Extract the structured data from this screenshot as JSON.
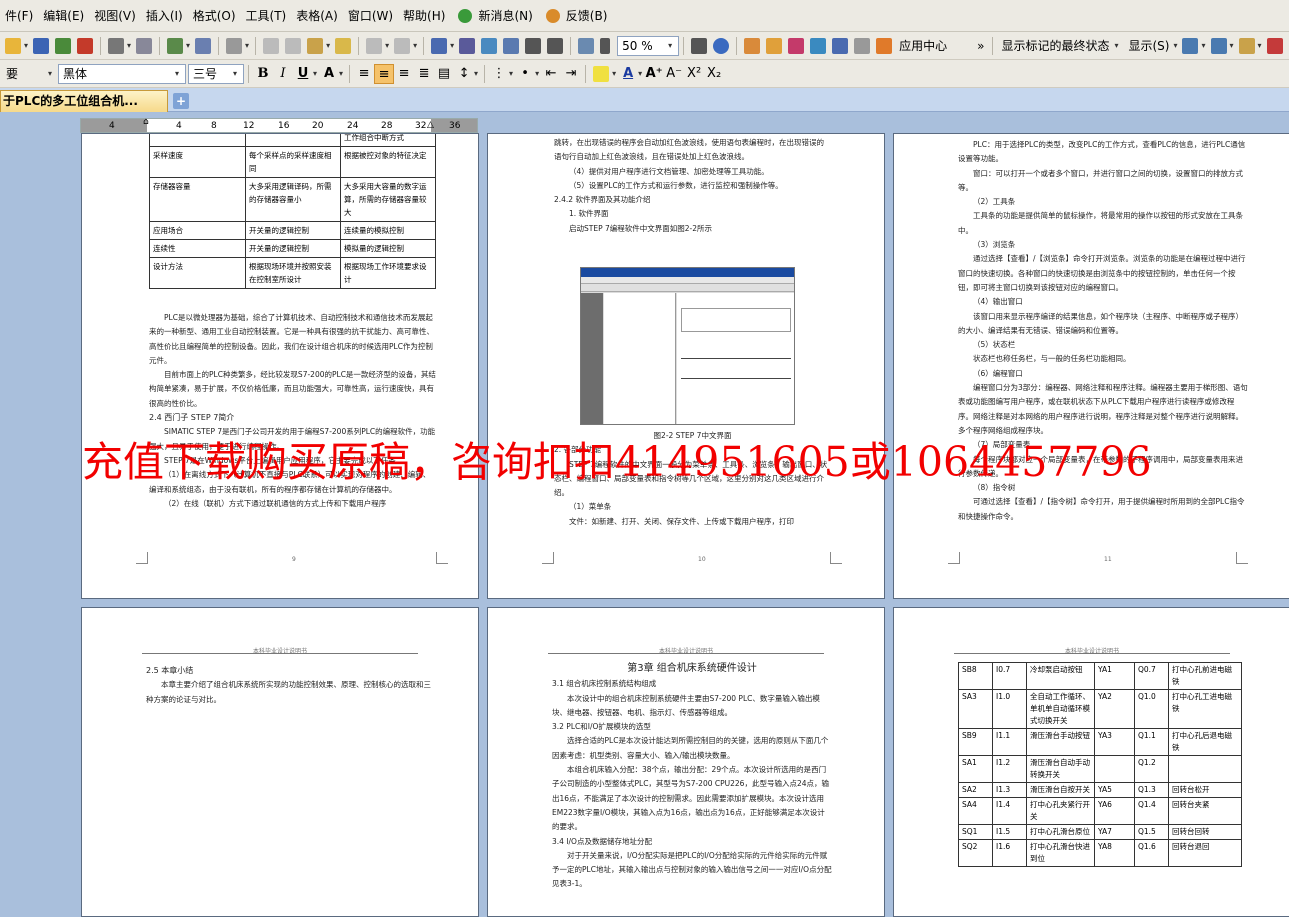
{
  "menu": [
    "件(F)",
    "编辑(E)",
    "视图(V)",
    "插入(I)",
    "格式(O)",
    "工具(T)",
    "表格(A)",
    "窗口(W)",
    "帮助(H)",
    "新消息(N)",
    "反馈(B)"
  ],
  "toolbar": {
    "zoom": "50 %",
    "app_center": "应用中心",
    "markup": "显示标记的最终状态",
    "show": "显示(S)",
    "style": "要",
    "font": "黑体",
    "size": "三号",
    "bold": "B",
    "italic": "I",
    "underline": "U",
    "text_font": "A",
    "superscript": "X²",
    "subscript": "X₂"
  },
  "tab": {
    "title": "于PLC的多工位组合机...",
    "add": "+"
  },
  "ruler": [
    "4",
    "4",
    "8",
    "12",
    "16",
    "20",
    "24",
    "28",
    "32",
    "36"
  ],
  "watermark": "充值下载购买原稿，咨询扣扣414951605或1064457796",
  "page1": {
    "rows": [
      [
        "",
        "",
        "工作组合中断方式"
      ],
      [
        "采样速度",
        "每个采样点的采样速度相同",
        "根据被控对象的特征决定"
      ],
      [
        "存储器容量",
        "大多采用逻辑译码，所需的存储器容量小",
        "大多采用大容量的数字运算，所需的存储器容量较大"
      ],
      [
        "应用场合",
        "开关量的逻辑控制",
        "连续量的模拟控制"
      ],
      [
        "连续性",
        "开关量的逻辑控制",
        "模拟量的逻辑控制"
      ],
      [
        "设计方法",
        "根据现场环境并按照安装在控制室所设计",
        "根据现场工作环境要求设计"
      ]
    ],
    "para1": "PLC是以微处理器为基础，综合了计算机技术、自动控制技术和通信技术而发展起来的一种新型、通用工业自动控制装置。它是一种具有很强的抗干扰能力、高可靠性、高性价比且编程简单的控制设备。因此，我们在设计组合机床的时候选用PLC作为控制元件。",
    "para2": "目前市面上的PLC种类繁多，经比较发现S7-200的PLC是一款经济型的设备，其结构简单紧凑，易于扩展，不仅价格低廉，而且功能强大，可靠性高，运行速度快，具有很高的性价比。",
    "heading": "2.4 西门子 STEP 7简介",
    "para3": "SIMATIC STEP 7是西门子公司开发的用于编程S7-200系列PLC的编程软件，功能强大，且易于使用，便于进行编程操作。",
    "para4": "STEP 7是在Windows平台上编辑用户应用程序，它主要完成以下任务。",
    "para5": "（1）在离线方式下（计算机不直接与PLC联系）可以实现对程序的创建、编辑、编译和系统组态，由于没有联机，所有的程序都存储在计算机的存储器中。",
    "para6": "（2）在线（联机）方式下通过联机通信的方式上传和下载用户程序",
    "pnum": "9"
  },
  "page2": {
    "p1": "跳转，在出现错误的程序会自动加红色波浪线，使用语句表编程时，在出现错误的语句行自动加上红色波浪线，且在错误处加上红色波浪线。",
    "p2": "（4）提供对用户程序进行文档管理、加密处理等工具功能。",
    "p3": "（5）设置PLC的工作方式和运行参数，进行监控和强制操作等。",
    "h1": "2.4.2 软件界面及其功能介绍",
    "h2": "1. 软件界面",
    "p4": "启动STEP 7编程软件中文界面如图2-2所示",
    "caption": "图2-2 STEP 7中文界面",
    "h3": "2. 各部分功能",
    "p5": "STEP 7编程软件的中文界面一般分为菜单条、工具条、浏览条、输出窗口、状态栏、编程窗口、局部变量表和指令树等几个区域，这里分别对这几类区域进行介绍。",
    "h4": "（1）菜单条",
    "p6": "文件：如新建、打开、关闭、保存文件、上传或下载用户程序，打印",
    "pnum": "10"
  },
  "page3": {
    "p1": "PLC：用于选择PLC的类型，改变PLC的工作方式，查看PLC的信息，进行PLC通信设置等功能。",
    "p2": "窗口：可以打开一个或者多个窗口，并进行窗口之间的切换，设置窗口的排放方式等。",
    "h1": "（2）工具条",
    "p3": "工具条的功能是提供简单的鼠标操作，将最常用的操作以按钮的形式安放在工具条中。",
    "h2": "（3）浏览条",
    "p4": "通过选择【查看】/【浏览条】命令打开浏览条。浏览条的功能是在编程过程中进行窗口的快速切换。各种窗口的快速切换是由浏览条中的按钮控制的，单击任何一个按钮，即可将主窗口切换到该按钮对应的编程窗口。",
    "h3": "（4）输出窗口",
    "p5": "该窗口用来显示程序编译的结果信息，如个程序块（主程序、中断程序或子程序）的大小、编译结果有无错误、错误编码和位置等。",
    "h4": "（5）状态栏",
    "p6": "状态栏也称任务栏，与一般的任务栏功能相同。",
    "h5": "（6）编程窗口",
    "p7": "编程窗口分为3部分：编程器、网络注释和程序注释。编程器主要用于梯形图、语句表或功能图编写用户程序，或在联机状态下从PLC下载用户程序进行读程序或修改程序。网络注释是对本网络的用户程序进行说明，程序注释是对整个程序进行说明解释。多个程序网络组成程序块。",
    "h6": "（7）局部变量表",
    "p8": "每个程序块都对应一个局部变量表，在带参数的子程序调用中，局部变量表用来进行参数传递。",
    "h7": "（8）指令树",
    "p9": "可通过选择【查看】/【指令树】命令打开，用于提供编程时所用到的全部PLC指令和快捷操作命令。",
    "pnum": "11"
  },
  "page4": {
    "hdr": "本科毕业设计说明书",
    "h": "2.5 本章小结",
    "p": "本章主要介绍了组合机床系统所实现的功能控制效果、原理、控制核心的选取和三种方案的论证与对比。"
  },
  "page5": {
    "hdr": "本科毕业设计说明书",
    "title": "第3章 组合机床系统硬件设计",
    "h1": "3.1 组合机床控制系统结构组成",
    "p1": "本次设计中的组合机床控制系统硬件主要由S7-200 PLC、数字量输入输出模块、继电器、按钮器、电机、指示灯、传感器等组成。",
    "h2": "3.2 PLC和I/O扩展模块的选型",
    "p2": "选择合适的PLC是本次设计能达到所需控制目的的关键，选用的原则从下面几个因素考虑：机型类别、容量大小、输入/输出模块数量。",
    "p3": "本组合机床输入分配：38个点，输出分配：29个点。本次设计所选用的是西门子公司制造的小型整体式PLC，其型号为S7-200 CPU226，此型号输入点24点，输出16点，不能满足了本次设计的控制需求。因此需要添加扩展模块。本次设计选用EM223数字量I/O模块，其输入点为16点，输出点为16点，正好能够满足本次设计的要求。",
    "h3": "3.4 I/O点及数据储存地址分配",
    "p4": "对于开关量来说，I/O分配实际是把PLC的I/O分配给实际的元件给实际的元件赋予一定的PLC地址，其输入输出点与控制对象的输入输出信号之间一一对应I/O点分配见表3-1。"
  },
  "page6": {
    "hdr": "本科毕业设计说明书",
    "rows": [
      [
        "SB8",
        "I0.7",
        "冷却泵启动按钮",
        "YA1",
        "Q0.7",
        "打中心孔前进电磁铁"
      ],
      [
        "SA3",
        "I1.0",
        "全自动工作循环、单机单自动循环模式切换开关",
        "YA2",
        "Q1.0",
        "打中心孔工进电磁铁"
      ],
      [
        "SB9",
        "I1.1",
        "滑压滑台手动按钮",
        "YA3",
        "Q1.1",
        "打中心孔后退电磁铁"
      ],
      [
        "SA1",
        "I1.2",
        "滑压滑台自动手动转换开关",
        "",
        "Q1.2",
        ""
      ],
      [
        "SA2",
        "I1.3",
        "滑压滑台自按开关",
        "YA5",
        "Q1.3",
        "回转台松开"
      ],
      [
        "SA4",
        "I1.4",
        "打中心孔夹紧行开关",
        "YA6",
        "Q1.4",
        "回转台夹紧"
      ],
      [
        "SQ1",
        "I1.5",
        "打中心孔滑台原位",
        "YA7",
        "Q1.5",
        "回转台回转"
      ],
      [
        "SQ2",
        "I1.6",
        "打中心孔滑台快进到位",
        "YA8",
        "Q1.6",
        "回转台退回"
      ]
    ]
  }
}
